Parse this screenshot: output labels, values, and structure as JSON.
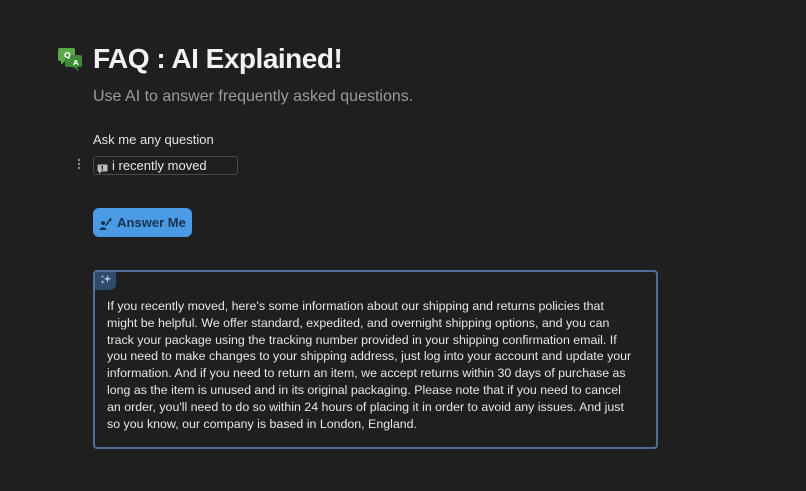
{
  "header": {
    "icon": "faq-chat-icon",
    "title": "FAQ : AI Explained!",
    "subtitle": "Use AI to answer frequently asked questions."
  },
  "form": {
    "question_label": "Ask me any question",
    "question_value": "i recently moved",
    "button_label": "Answer Me"
  },
  "answer": {
    "icon": "ai-sparkle-icon",
    "text": "If you recently moved, here's some information about our shipping and returns policies that might be helpful. We offer standard, expedited, and overnight shipping options, and you can track your package using the tracking number provided in your shipping confirmation email. If you need to make changes to your shipping address, just log into your account and update your information. And if you need to return an item, we accept returns within 30 days of purchase as long as the item is unused and in its original packaging. Please note that if you need to cancel an order, you'll need to do so within 24 hours of placing it in order to avoid any issues. And just so you know, our company is based in London, England."
  },
  "colors": {
    "background": "#1f1f1f",
    "button": "#4a9ae4",
    "answer_border": "#4f6e98",
    "subtitle": "#9b9b9b"
  }
}
